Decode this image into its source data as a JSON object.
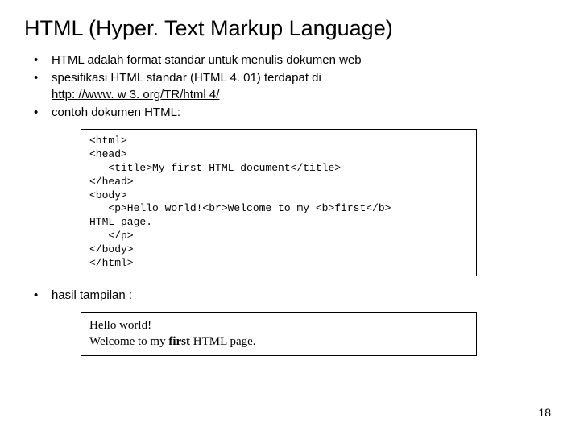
{
  "title": "HTML (Hyper. Text Markup Language)",
  "bullets": {
    "b1": "HTML adalah format standar untuk menulis dokumen web",
    "b2_pre": "spesifikasi HTML standar (HTML 4. 01) terdapat di ",
    "b2_link": "http: //www. w 3. org/TR/html 4/",
    "b3": "contoh dokumen HTML:",
    "b4": "hasil tampilan :"
  },
  "code": "<html>\n<head>\n   <title>My first HTML document</title>\n</head>\n<body>\n   <p>Hello world!<br>Welcome to my <b>first</b>\nHTML page.\n   </p>\n</body>\n</html>",
  "render": {
    "line1": "Hello world!",
    "line2_pre": "Welcome to my ",
    "line2_bold": "first",
    "line2_post": " HTML page."
  },
  "page_number": "18"
}
